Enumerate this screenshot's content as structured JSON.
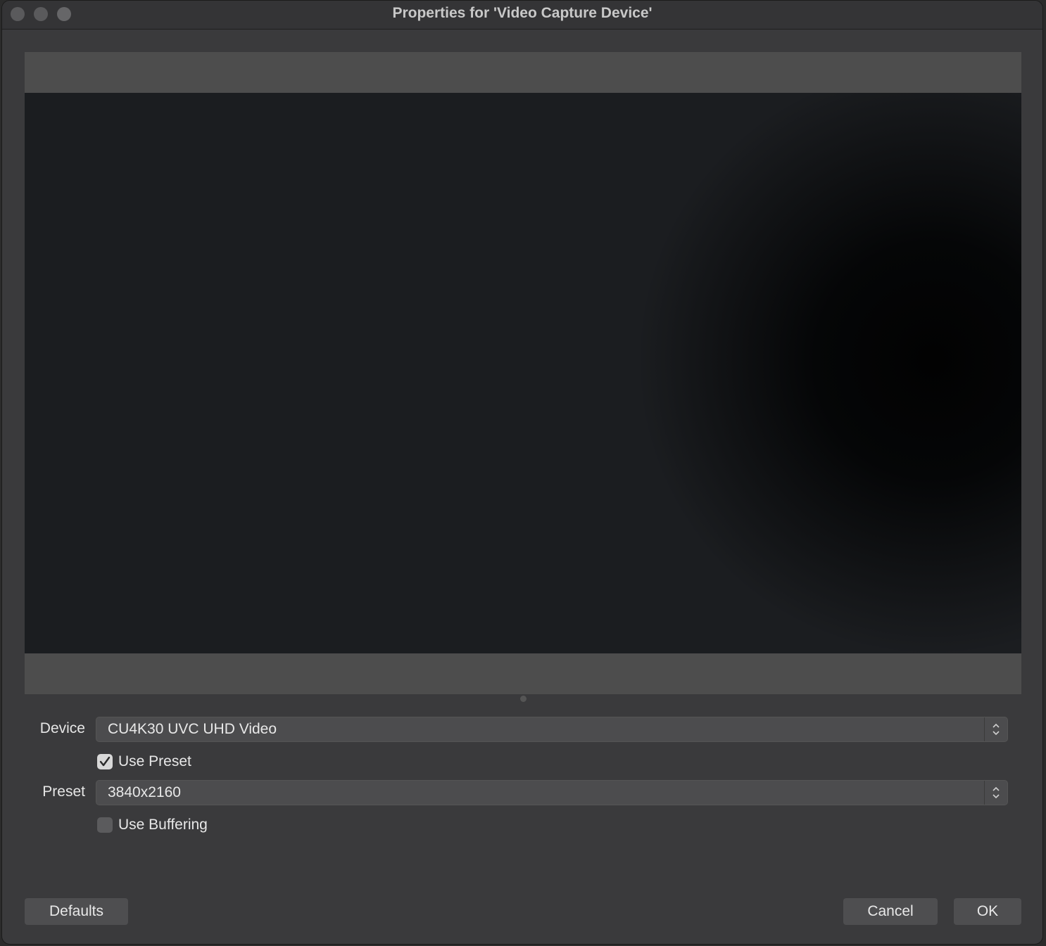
{
  "window": {
    "title": "Properties for 'Video Capture Device'"
  },
  "form": {
    "device_label": "Device",
    "device_value": "CU4K30 UVC UHD Video",
    "use_preset_label": "Use Preset",
    "use_preset_checked": true,
    "preset_label": "Preset",
    "preset_value": "3840x2160",
    "use_buffering_label": "Use Buffering",
    "use_buffering_checked": false
  },
  "buttons": {
    "defaults": "Defaults",
    "cancel": "Cancel",
    "ok": "OK"
  }
}
